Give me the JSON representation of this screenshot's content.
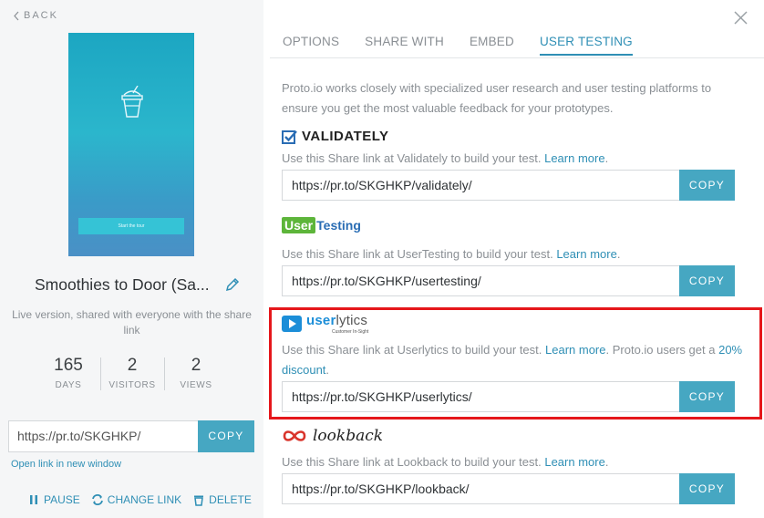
{
  "left": {
    "back_label": "BACK",
    "preview_button": "Start the tour",
    "project_title": "Smoothies to Door (Sa...",
    "description": "Live version, shared with everyone with the share link",
    "stats": [
      {
        "value": "165",
        "label": "DAYS"
      },
      {
        "value": "2",
        "label": "VISITORS"
      },
      {
        "value": "2",
        "label": "VIEWS"
      }
    ],
    "share_url": "https://pr.to/SKGHKP/",
    "copy_label": "COPY",
    "open_link": "Open link in new window",
    "actions": {
      "pause": "PAUSE",
      "change_link": "CHANGE LINK",
      "delete": "DELETE"
    }
  },
  "tabs": [
    {
      "label": "OPTIONS",
      "active": false
    },
    {
      "label": "SHARE WITH",
      "active": false
    },
    {
      "label": "EMBED",
      "active": false
    },
    {
      "label": "USER TESTING",
      "active": true
    }
  ],
  "intro": "Proto.io works closely with specialized user research and user testing platforms to ensure you get the most valuable feedback for your prototypes.",
  "platforms": {
    "validately": {
      "logo_text": "VALIDATELY",
      "desc": "Use this Share link at Validately to build your test.",
      "learn": "Learn more",
      "url": "https://pr.to/SKGHKP/validately/",
      "copy": "COPY"
    },
    "usertesting": {
      "logo_user": "User",
      "logo_testing": "Testing",
      "desc": "Use this Share link at UserTesting to build your test.",
      "learn": "Learn more",
      "url": "https://pr.to/SKGHKP/usertesting/",
      "copy": "COPY"
    },
    "userlytics": {
      "logo_user": "user",
      "logo_lytics": "lytics",
      "logo_tag": "Customer In-Sight",
      "desc": "Use this Share link at Userlytics to build your test.",
      "learn": "Learn more",
      "extra": "Proto.io users get a",
      "discount": "20% discount",
      "url": "https://pr.to/SKGHKP/userlytics/",
      "copy": "COPY"
    },
    "lookback": {
      "logo_text": "lookback",
      "desc": "Use this Share link at Lookback to build your test.",
      "learn": "Learn more",
      "url": "https://pr.to/SKGHKP/lookback/",
      "copy": "COPY"
    }
  },
  "colors": {
    "accent": "#46a7c2",
    "link": "#2f8fb5",
    "highlight": "#e5171b"
  }
}
